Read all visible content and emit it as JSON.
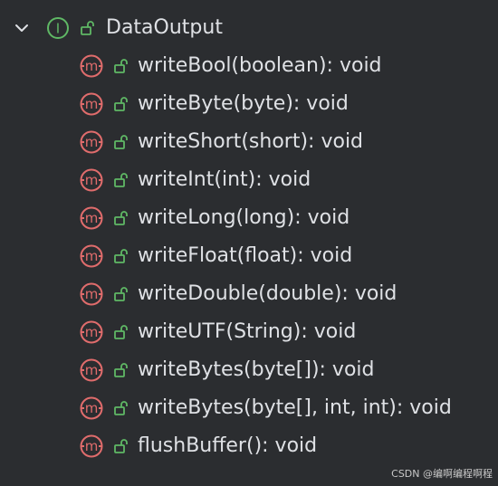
{
  "colors": {
    "background": "#2b2d30",
    "text": "#dfe1e5",
    "interface_icon": "#5fb865",
    "method_icon": "#e06c6c",
    "lock_icon": "#5fb865"
  },
  "tree": {
    "root": {
      "label": "DataOutput",
      "expanded": true,
      "icon": "interface-icon",
      "icon_letter": "I",
      "visibility_icon": "unlock-icon"
    },
    "methods": [
      {
        "label": "writeBool(boolean): void",
        "icon": "method-icon",
        "icon_letter": "m",
        "visibility_icon": "unlock-icon"
      },
      {
        "label": "writeByte(byte): void",
        "icon": "method-icon",
        "icon_letter": "m",
        "visibility_icon": "unlock-icon"
      },
      {
        "label": "writeShort(short): void",
        "icon": "method-icon",
        "icon_letter": "m",
        "visibility_icon": "unlock-icon"
      },
      {
        "label": "writeInt(int): void",
        "icon": "method-icon",
        "icon_letter": "m",
        "visibility_icon": "unlock-icon"
      },
      {
        "label": "writeLong(long): void",
        "icon": "method-icon",
        "icon_letter": "m",
        "visibility_icon": "unlock-icon"
      },
      {
        "label": "writeFloat(float): void",
        "icon": "method-icon",
        "icon_letter": "m",
        "visibility_icon": "unlock-icon"
      },
      {
        "label": "writeDouble(double): void",
        "icon": "method-icon",
        "icon_letter": "m",
        "visibility_icon": "unlock-icon"
      },
      {
        "label": "writeUTF(String): void",
        "icon": "method-icon",
        "icon_letter": "m",
        "visibility_icon": "unlock-icon"
      },
      {
        "label": "writeBytes(byte[]): void",
        "icon": "method-icon",
        "icon_letter": "m",
        "visibility_icon": "unlock-icon"
      },
      {
        "label": "writeBytes(byte[], int, int): void",
        "icon": "method-icon",
        "icon_letter": "m",
        "visibility_icon": "unlock-icon"
      },
      {
        "label": "flushBuffer(): void",
        "icon": "method-icon",
        "icon_letter": "m",
        "visibility_icon": "unlock-icon"
      }
    ]
  },
  "watermark": "CSDN @编啊编程啊程"
}
